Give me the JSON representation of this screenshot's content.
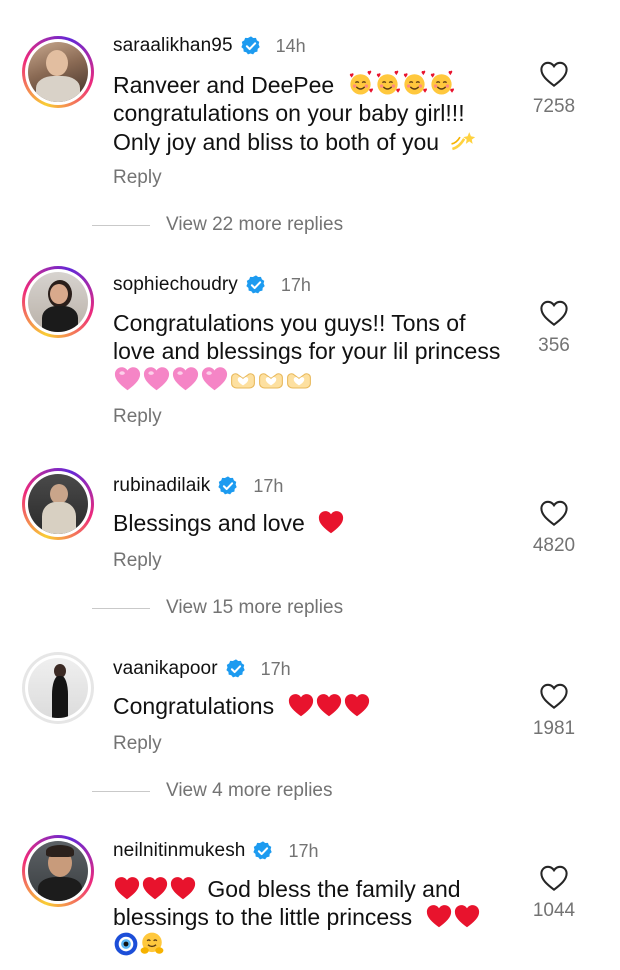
{
  "colors": {
    "accent_verified": "#1d9bf0",
    "muted": "#737373",
    "heart_red": "#e8132d",
    "heart_pink": "#f27fbf"
  },
  "comments": [
    {
      "username": "saraalikhan95",
      "time": "14h",
      "text_lines": [
        "Ranveer and DeePee",
        "congratulations on your baby girl!!!",
        "Only joy and bliss to both of you"
      ],
      "emojis": [
        "smiling-face-with-hearts x4",
        "dizzy"
      ],
      "reply_label": "Reply",
      "likes": "7258",
      "view_more": "View 22 more replies",
      "story_ring": true
    },
    {
      "username": "sophiechoudry",
      "time": "17h",
      "text_lines": [
        "Congratulations you guys!! Tons of",
        "love and blessings for your lil princess"
      ],
      "emojis": [
        "pink-heart x4",
        "heart-hands x3"
      ],
      "reply_label": "Reply",
      "likes": "356",
      "story_ring": true
    },
    {
      "username": "rubinadilaik",
      "time": "17h",
      "text_lines": [
        "Blessings and love"
      ],
      "emojis": [
        "red-heart"
      ],
      "reply_label": "Reply",
      "likes": "4820",
      "view_more": "View 15 more replies",
      "story_ring": true
    },
    {
      "username": "vaanikapoor",
      "time": "17h",
      "text_lines": [
        "Congratulations"
      ],
      "emojis": [
        "red-heart x3"
      ],
      "reply_label": "Reply",
      "likes": "1981",
      "view_more": "View 4 more replies",
      "story_ring": false
    },
    {
      "username": "neilnitinmukesh",
      "time": "17h",
      "text_lines": [
        "God bless the family and",
        "blessings to the little princess"
      ],
      "emojis": [
        "red-heart x3",
        "red-heart x2",
        "nazar-amulet",
        "hugging-face"
      ],
      "likes": "1044",
      "story_ring": true
    }
  ]
}
